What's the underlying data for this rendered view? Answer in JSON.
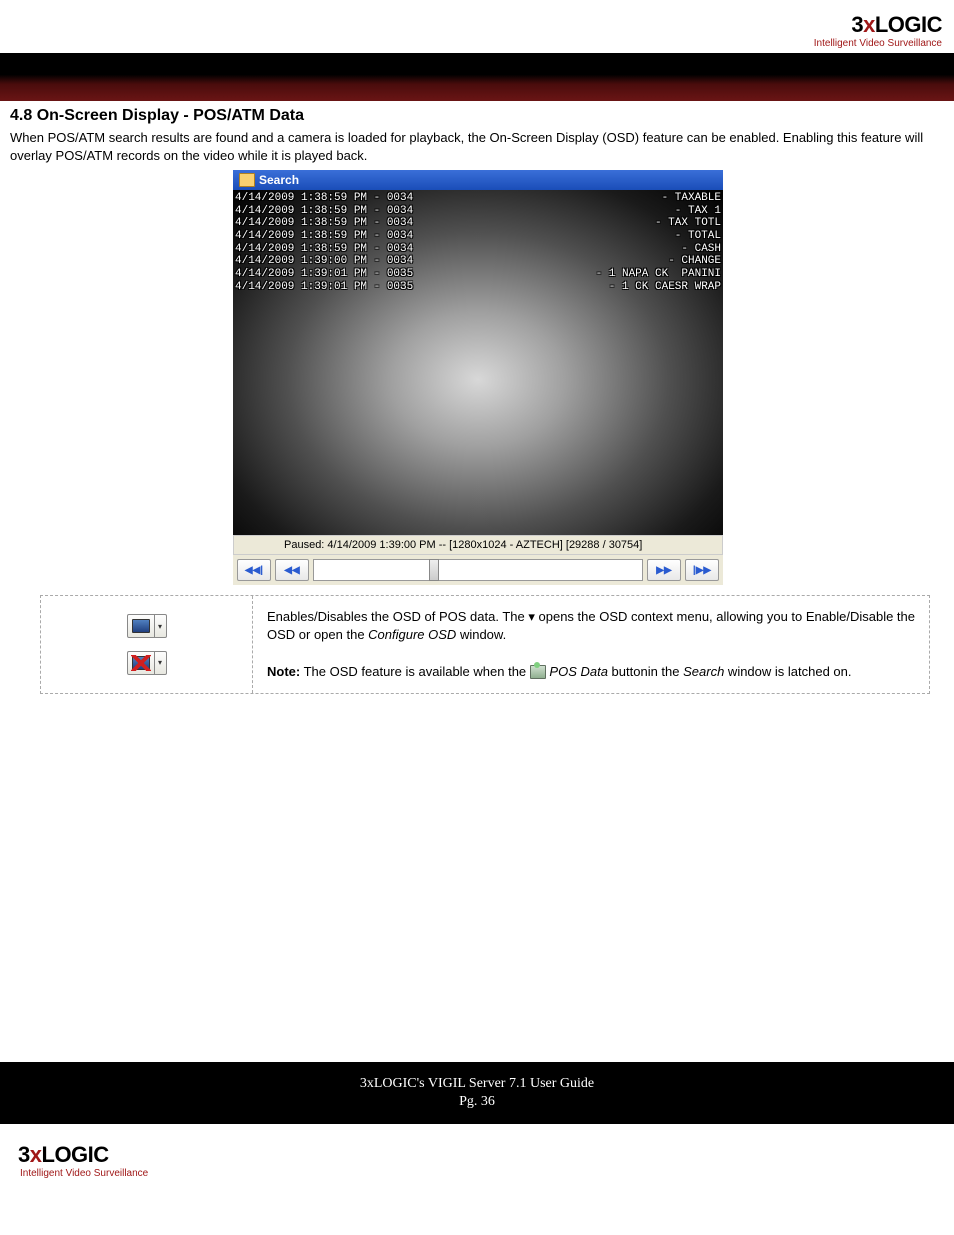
{
  "logo": {
    "three": "3",
    "x": "x",
    "logic": "LOGIC",
    "tagline": "Intelligent Video Surveillance"
  },
  "heading": "4.8 On-Screen Display - POS/ATM Data",
  "intro": "When POS/ATM search results are found and a camera is loaded for playback, the On-Screen Display (OSD) feature can be enabled. Enabling this feature will overlay POS/ATM records on the video while it is played back.",
  "search_window": {
    "title": "Search",
    "osd_rows": [
      {
        "l": "4/14/2009 1:38:59 PM - 0034",
        "r": "- TAXABLE"
      },
      {
        "l": "4/14/2009 1:38:59 PM - 0034",
        "r": "- TAX 1"
      },
      {
        "l": "4/14/2009 1:38:59 PM - 0034",
        "r": "- TAX TOTL"
      },
      {
        "l": "4/14/2009 1:38:59 PM - 0034",
        "r": "- TOTAL"
      },
      {
        "l": "4/14/2009 1:38:59 PM - 0034",
        "r": "- CASH"
      },
      {
        "l": "4/14/2009 1:39:00 PM - 0034",
        "r": "- CHANGE"
      },
      {
        "l": "4/14/2009 1:39:01 PM - 0035",
        "r": "- 1 NAPA CK  PANINI"
      },
      {
        "l": "4/14/2009 1:39:01 PM - 0035",
        "r": "- 1 CK CAESR WRAP"
      }
    ],
    "status": "Paused: 4/14/2009 1:39:00 PM  --  [1280x1024 - AZTECH] [29288 / 30754]"
  },
  "desc": {
    "line1a": "Enables/Disables the OSD of POS data. The ",
    "line1b": " opens the OSD context menu, allowing you to Enable/Disable the OSD or open the ",
    "configure": "Configure OSD",
    "line1c": " window.",
    "note_label": "Note:",
    "note_a": " The OSD feature is available when the ",
    "pos_data": "POS Data",
    "note_b": " buttonin the ",
    "search": "Search",
    "note_c": " window is latched on."
  },
  "footer": {
    "title": "3xLOGIC's VIGIL Server 7.1 User Guide",
    "page": "Pg. 36"
  },
  "glyphs": {
    "dropdown": "▾",
    "rewind_fast": "◀◀|",
    "rewind": "◀◀",
    "forward": "▶▶",
    "forward_fast": "|▶▶"
  }
}
